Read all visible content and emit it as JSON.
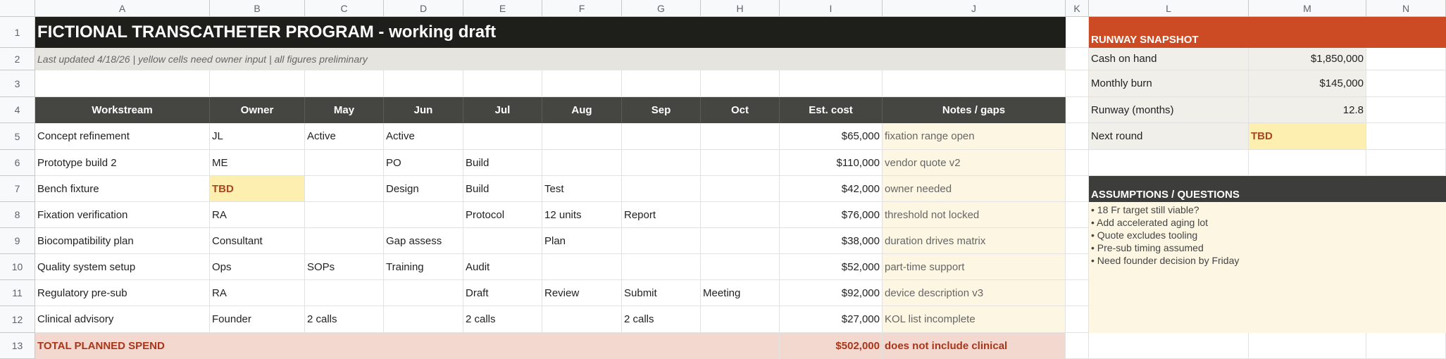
{
  "columns": [
    "A",
    "B",
    "C",
    "D",
    "E",
    "F",
    "G",
    "H",
    "I",
    "J",
    "K",
    "L",
    "M",
    "N"
  ],
  "rows": [
    "1",
    "2",
    "3",
    "4",
    "5",
    "6",
    "7",
    "8",
    "9",
    "10",
    "11",
    "12",
    "13"
  ],
  "title": "FICTIONAL TRANSCATHETER PROGRAM - working draft",
  "subtitle": "Last updated 4/18/26  |  yellow cells need owner input  |  all figures preliminary",
  "table": {
    "headers": [
      "Workstream",
      "Owner",
      "May",
      "Jun",
      "Jul",
      "Aug",
      "Sep",
      "Oct",
      "Est. cost",
      "Notes / gaps"
    ],
    "rows": [
      [
        "Concept refinement",
        "JL",
        "Active",
        "Active",
        "",
        "",
        "",
        "",
        "$65,000",
        "fixation range open"
      ],
      [
        "Prototype build 2",
        "ME",
        "",
        "PO",
        "Build",
        "",
        "",
        "",
        "$110,000",
        "vendor quote v2"
      ],
      [
        "Bench fixture",
        "TBD",
        "",
        "Design",
        "Build",
        "Test",
        "",
        "",
        "$42,000",
        "owner needed"
      ],
      [
        "Fixation verification",
        "RA",
        "",
        "",
        "Protocol",
        "12 units",
        "Report",
        "",
        "$76,000",
        "threshold not locked"
      ],
      [
        "Biocompatibility plan",
        "Consultant",
        "",
        "Gap assess",
        "",
        "Plan",
        "",
        "",
        "$38,000",
        "duration drives matrix"
      ],
      [
        "Quality system setup",
        "Ops",
        "SOPs",
        "Training",
        "Audit",
        "",
        "",
        "",
        "$52,000",
        "part-time support"
      ],
      [
        "Regulatory pre-sub",
        "RA",
        "",
        "",
        "Draft",
        "Review",
        "Submit",
        "Meeting",
        "$92,000",
        "device description v3"
      ],
      [
        "Clinical advisory",
        "Founder",
        "2 calls",
        "",
        "2 calls",
        "",
        "2 calls",
        "",
        "$27,000",
        "KOL list incomplete"
      ]
    ],
    "total": {
      "label": "TOTAL PLANNED SPEND",
      "value": "$502,000",
      "note": "does not include clinical"
    }
  },
  "runway": {
    "title": "RUNWAY SNAPSHOT",
    "items": [
      {
        "label": "Cash on hand",
        "value": "$1,850,000"
      },
      {
        "label": "Monthly burn",
        "value": "$145,000"
      },
      {
        "label": "Runway (months)",
        "value": "12.8"
      },
      {
        "label": "Next round",
        "value": "TBD"
      }
    ]
  },
  "assumptions": {
    "title": "ASSUMPTIONS / QUESTIONS",
    "items": [
      "• 18 Fr target still viable?",
      "• Add accelerated aging lot",
      "• Quote excludes tooling",
      "• Pre-sub timing assumed",
      "• Need founder decision by Friday"
    ]
  },
  "colors": {
    "title_bg": "#1e1e1a",
    "header_bg": "#454542",
    "runway_bg": "#cc4b24",
    "input_yellow": "#fdefb0",
    "total_bg": "#f3d8cf"
  }
}
